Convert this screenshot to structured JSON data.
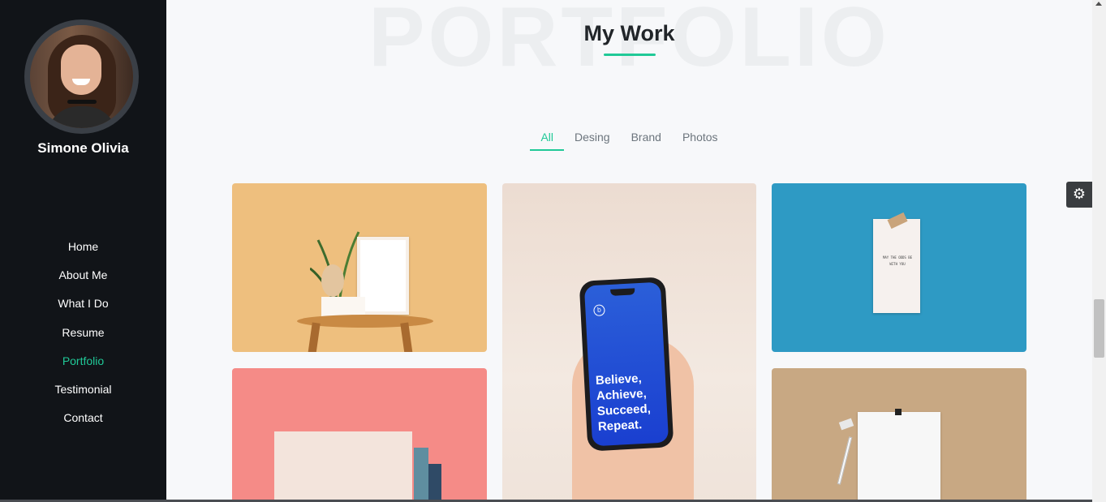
{
  "sidebar": {
    "name": "Simone Olivia",
    "nav": [
      {
        "label": "Home",
        "active": false
      },
      {
        "label": "About Me",
        "active": false
      },
      {
        "label": "What I Do",
        "active": false
      },
      {
        "label": "Resume",
        "active": false
      },
      {
        "label": "Portfolio",
        "active": true
      },
      {
        "label": "Testimonial",
        "active": false
      },
      {
        "label": "Contact",
        "active": false
      }
    ]
  },
  "section": {
    "bg_title": "PORTFOLIO",
    "title": "My Work"
  },
  "filters": [
    {
      "label": "All",
      "active": true
    },
    {
      "label": "Desing",
      "active": false
    },
    {
      "label": "Brand",
      "active": false
    },
    {
      "label": "Photos",
      "active": false
    }
  ],
  "portfolio": {
    "phone_text": "Believe, Achieve, Succeed, Repeat.",
    "note_text": "MAY THE ODDS BE WITH YOU"
  },
  "colors": {
    "accent": "#20c997",
    "sidebar_bg": "#111418"
  },
  "icons": {
    "settings": "gear-icon"
  }
}
